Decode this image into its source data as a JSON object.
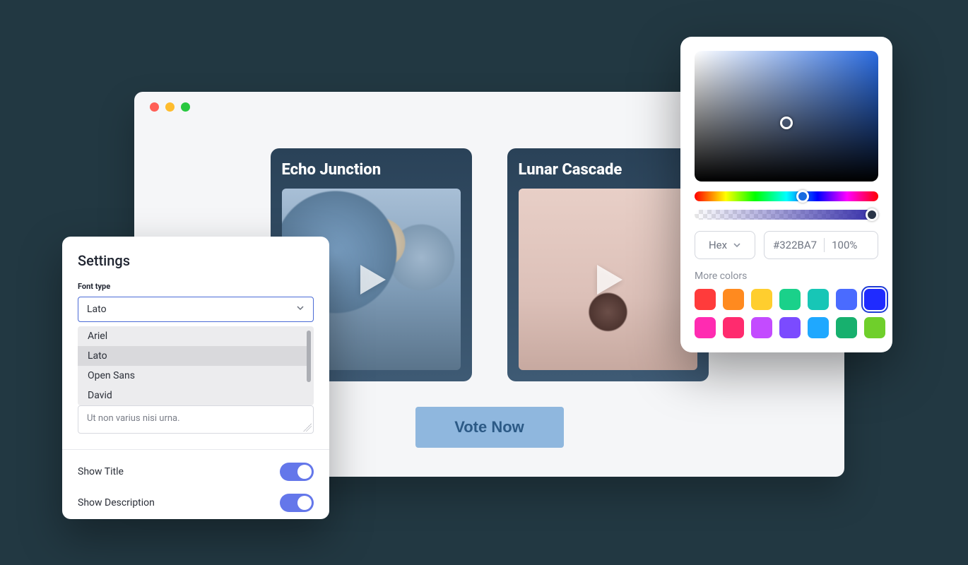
{
  "cards": [
    {
      "title": "Echo Junction"
    },
    {
      "title": "Lunar Cascade"
    }
  ],
  "vote_button": "Vote Now",
  "settings": {
    "title": "Settings",
    "font_type_label": "Font type",
    "font_selected": "Lato",
    "font_options": [
      "Ariel",
      "Lato",
      "Open Sans",
      "David"
    ],
    "textarea_value": "Ut non varius nisi urna.",
    "show_title_label": "Show Title",
    "show_title": true,
    "show_description_label": "Show Description",
    "show_description": true
  },
  "color_picker": {
    "format_label": "Hex",
    "hex_value": "#322BA7",
    "alpha_value": "100%",
    "more_colors_label": "More colors",
    "swatches": [
      "#ff3b3b",
      "#ff8a1f",
      "#ffce2e",
      "#1ad18a",
      "#17c6b6",
      "#4a6bff",
      "#1f2bff",
      "#ff2bb1",
      "#ff2b6e",
      "#c34bff",
      "#7b4bff",
      "#1fa8ff",
      "#17b06e",
      "#6fcf2b"
    ],
    "selected_swatch_index": 6
  }
}
